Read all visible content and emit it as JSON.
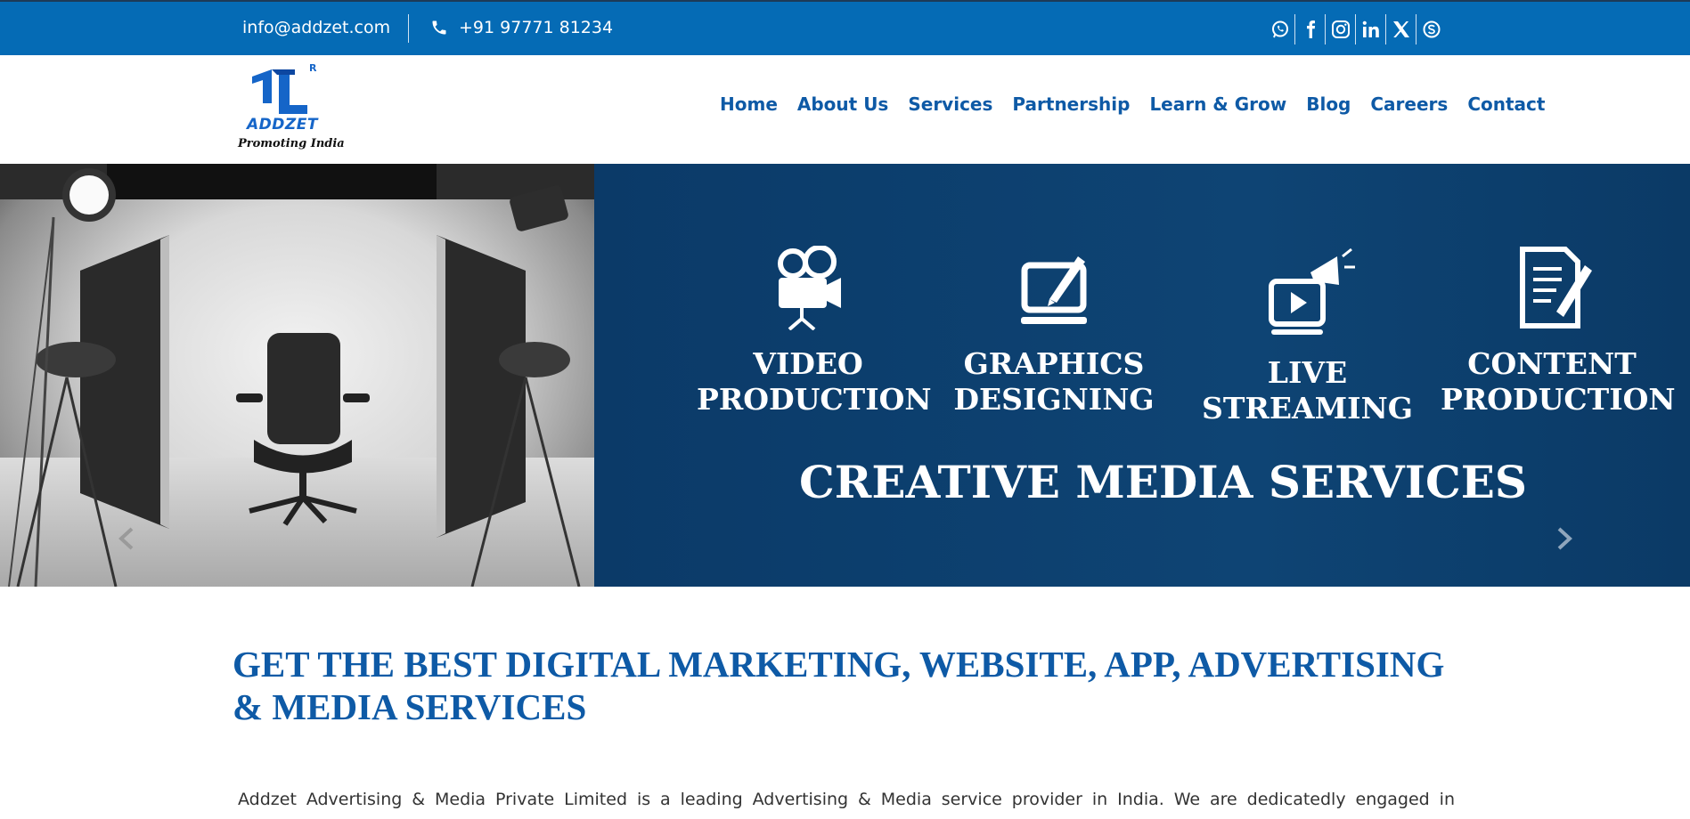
{
  "topbar": {
    "email": "info@addzet.com",
    "phone": "+91 97771 81234",
    "socials": [
      "whatsapp-icon",
      "facebook-icon",
      "instagram-icon",
      "linkedin-icon",
      "x-icon",
      "skype-icon"
    ]
  },
  "logo": {
    "brand": "ADDZET",
    "tagline": "Promoting India",
    "registered": "R"
  },
  "nav": {
    "items": [
      "Home",
      "About Us",
      "Services",
      "Partnership",
      "Learn & Grow",
      "Blog",
      "Careers",
      "Contact"
    ]
  },
  "hero": {
    "services": [
      {
        "line1": "VIDEO",
        "line2": "PRODUCTION",
        "icon": "video-camera-icon"
      },
      {
        "line1": "GRAPHICS",
        "line2": "DESIGNING",
        "icon": "laptop-pen-icon"
      },
      {
        "line1": "LIVE",
        "line2": "STREAMING",
        "icon": "live-stream-icon"
      },
      {
        "line1": "CONTENT",
        "line2": "PRODUCTION",
        "icon": "document-pen-icon"
      }
    ],
    "title": "CREATIVE MEDIA SERVICES",
    "prev": "‹",
    "next": "›"
  },
  "main": {
    "headline": "GET THE BEST DIGITAL MARKETING, WEBSITE, APP, ADVERTISING & MEDIA SERVICES",
    "intro": "Addzet Advertising & Media Private Limited is a leading Advertising & Media service provider in India. We are dedicatedly engaged in simplifying your"
  },
  "colors": {
    "topbar": "#056bb5",
    "nav_text": "#0e5aa6",
    "hero_blue": "#0d3e6b",
    "headline": "#0e5aa6"
  }
}
